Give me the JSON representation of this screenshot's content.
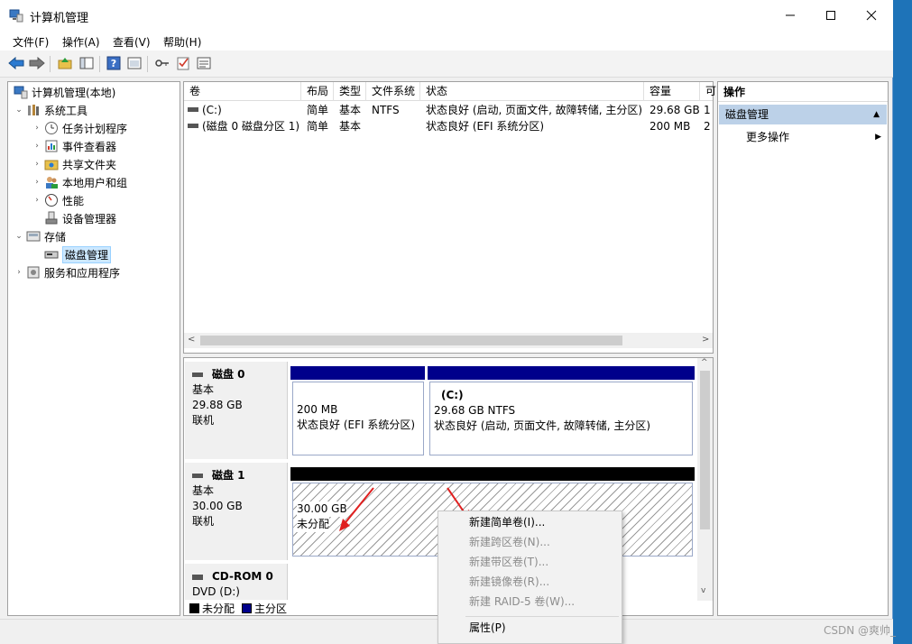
{
  "window": {
    "title": "计算机管理"
  },
  "menu": [
    "文件(F)",
    "操作(A)",
    "查看(V)",
    "帮助(H)"
  ],
  "tree": {
    "root": "计算机管理(本地)",
    "system_tools": "系统工具",
    "task_scheduler": "任务计划程序",
    "event_viewer": "事件查看器",
    "shared_folders": "共享文件夹",
    "local_users": "本地用户和组",
    "performance": "性能",
    "device_manager": "设备管理器",
    "storage": "存储",
    "disk_management": "磁盘管理",
    "services_apps": "服务和应用程序"
  },
  "volume_table": {
    "headers": [
      "卷",
      "布局",
      "类型",
      "文件系统",
      "状态",
      "容量",
      "可"
    ],
    "rows": [
      [
        "(C:)",
        "简单",
        "基本",
        "NTFS",
        "状态良好 (启动, 页面文件, 故障转储, 主分区)",
        "29.68 GB",
        "1"
      ],
      [
        "(磁盘 0 磁盘分区 1)",
        "简单",
        "基本",
        "",
        "状态良好 (EFI 系统分区)",
        "200 MB",
        "2"
      ]
    ]
  },
  "disks": {
    "disk0": {
      "name": "磁盘 0",
      "type": "基本",
      "size": "29.88 GB",
      "state": "联机",
      "p1": {
        "size": "200 MB",
        "status": "状态良好 (EFI 系统分区)"
      },
      "p2": {
        "label": "(C:)",
        "size": "29.68 GB NTFS",
        "status": "状态良好 (启动, 页面文件, 故障转储, 主分区)"
      }
    },
    "disk1": {
      "name": "磁盘 1",
      "type": "基本",
      "size": "30.00 GB",
      "state": "联机",
      "p1": {
        "size": "30.00 GB",
        "status": "未分配"
      }
    },
    "cdrom": {
      "name": "CD-ROM 0",
      "type": "DVD (D:)"
    }
  },
  "legend": {
    "unallocated": "未分配",
    "primary": "主分区"
  },
  "actions": {
    "header": "操作",
    "section": "磁盘管理",
    "more": "更多操作"
  },
  "context_menu": {
    "new_simple": "新建简单卷(I)...",
    "new_spanned": "新建跨区卷(N)...",
    "new_striped": "新建带区卷(T)...",
    "new_mirrored": "新建镜像卷(R)...",
    "new_raid5": "新建 RAID-5 卷(W)...",
    "properties": "属性(P)"
  },
  "watermark": "CSDN @爽帅_",
  "colors": {
    "primary_bar": "#00008b",
    "unallocated_bar": "#000000",
    "selection": "#cce8ff",
    "annotation_arrow": "#e02020"
  }
}
